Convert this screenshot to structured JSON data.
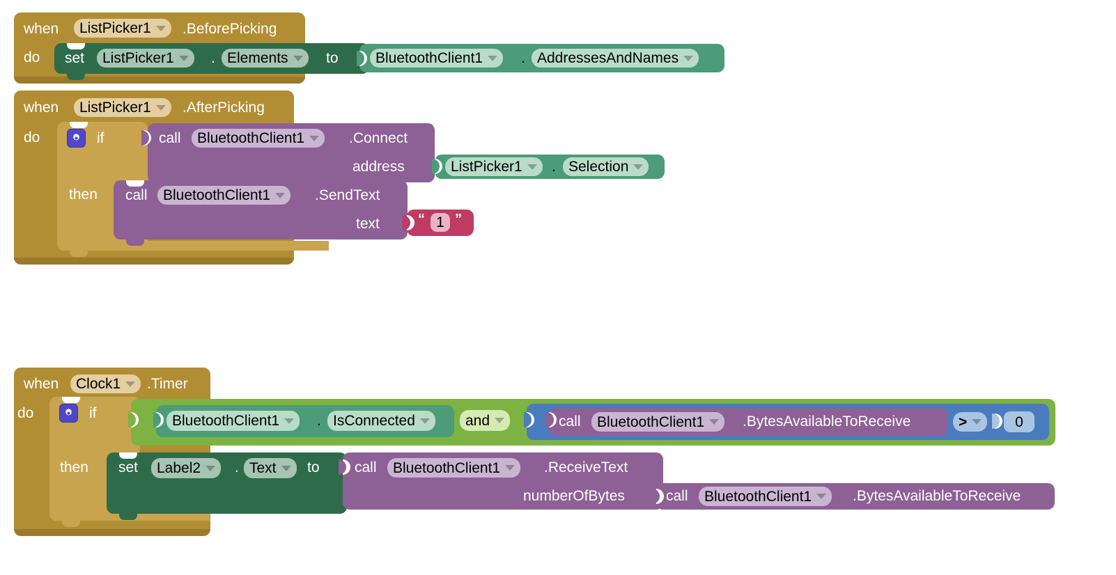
{
  "app": {
    "title": "MIT App Inventor Blocks Editor",
    "canvas_background": "#ffffff"
  },
  "palette": {
    "event_block": "#b18d33",
    "setter_block": "#2e6b4b",
    "getter_block": "#4c9b79",
    "logic_block": "#7cb342",
    "method_block": "#8d6096",
    "math_block": "#4a7bbd",
    "text_block": "#bf3b63",
    "mutator_icon": "#4f46c8"
  },
  "blocks": [
    {
      "id": "event-listpicker1-beforepicking",
      "type": "event",
      "when_label": "when",
      "component": "ListPicker1",
      "event_name": ".BeforePicking",
      "do_label": "do",
      "body": {
        "id": "set-listpicker1-elements",
        "type": "setter",
        "set_label": "set",
        "component": "ListPicker1",
        "dot": ".",
        "property": "Elements",
        "to_label": "to",
        "value": {
          "id": "get-bluetoothclient1-addressesandnames",
          "type": "getter",
          "component": "BluetoothClient1",
          "dot": ".",
          "property": "AddressesAndNames"
        }
      }
    },
    {
      "id": "event-listpicker1-afterpicking",
      "type": "event",
      "when_label": "when",
      "component": "ListPicker1",
      "event_name": ".AfterPicking",
      "do_label": "do",
      "body": {
        "id": "control-if-then-1",
        "type": "control-if",
        "mutator_icon": "gear-icon",
        "if_label": "if",
        "then_label": "then",
        "condition": {
          "id": "call-bluetoothclient1-connect",
          "type": "method-call",
          "call_label": "call",
          "component": "BluetoothClient1",
          "method": ".Connect",
          "args": [
            {
              "name": "address",
              "value": {
                "id": "get-listpicker1-selection",
                "type": "getter",
                "component": "ListPicker1",
                "dot": ".",
                "property": "Selection"
              }
            }
          ]
        },
        "then_body": {
          "id": "call-bluetoothclient1-sendtext",
          "type": "method-call",
          "call_label": "call",
          "component": "BluetoothClient1",
          "method": ".SendText",
          "args": [
            {
              "name": "text",
              "value": {
                "id": "text-string-1",
                "type": "text",
                "open_quote": "“",
                "close_quote": "”",
                "value": "1"
              }
            }
          ]
        }
      }
    },
    {
      "id": "event-clock1-timer",
      "type": "event",
      "when_label": "when",
      "component": "Clock1",
      "event_name": ".Timer",
      "do_label": "do",
      "body": {
        "id": "control-if-then-2",
        "type": "control-if",
        "mutator_icon": "gear-icon",
        "if_label": "if",
        "then_label": "then",
        "condition": {
          "id": "logic-and",
          "type": "logic-and",
          "operator": "and",
          "left": {
            "id": "get-bluetoothclient1-isconnected",
            "type": "getter",
            "component": "BluetoothClient1",
            "dot": ".",
            "property": "IsConnected"
          },
          "right": {
            "id": "math-compare-gt",
            "type": "math-compare",
            "operator": ">",
            "left": {
              "id": "call-bluetoothclient1-bytesavailable-1",
              "type": "method-call",
              "call_label": "call",
              "component": "BluetoothClient1",
              "method": ".BytesAvailableToReceive"
            },
            "right": {
              "id": "number-zero",
              "type": "number",
              "value": "0"
            }
          }
        },
        "then_body": {
          "id": "set-label2-text",
          "type": "setter",
          "set_label": "set",
          "component": "Label2",
          "dot": ".",
          "property": "Text",
          "to_label": "to",
          "value": {
            "id": "call-bluetoothclient1-receivetext",
            "type": "method-call",
            "call_label": "call",
            "component": "BluetoothClient1",
            "method": ".ReceiveText",
            "args": [
              {
                "name": "numberOfBytes",
                "value": {
                  "id": "call-bluetoothclient1-bytesavailable-2",
                  "type": "method-call",
                  "call_label": "call",
                  "component": "BluetoothClient1",
                  "method": ".BytesAvailableToReceive"
                }
              }
            ]
          }
        }
      }
    }
  ]
}
